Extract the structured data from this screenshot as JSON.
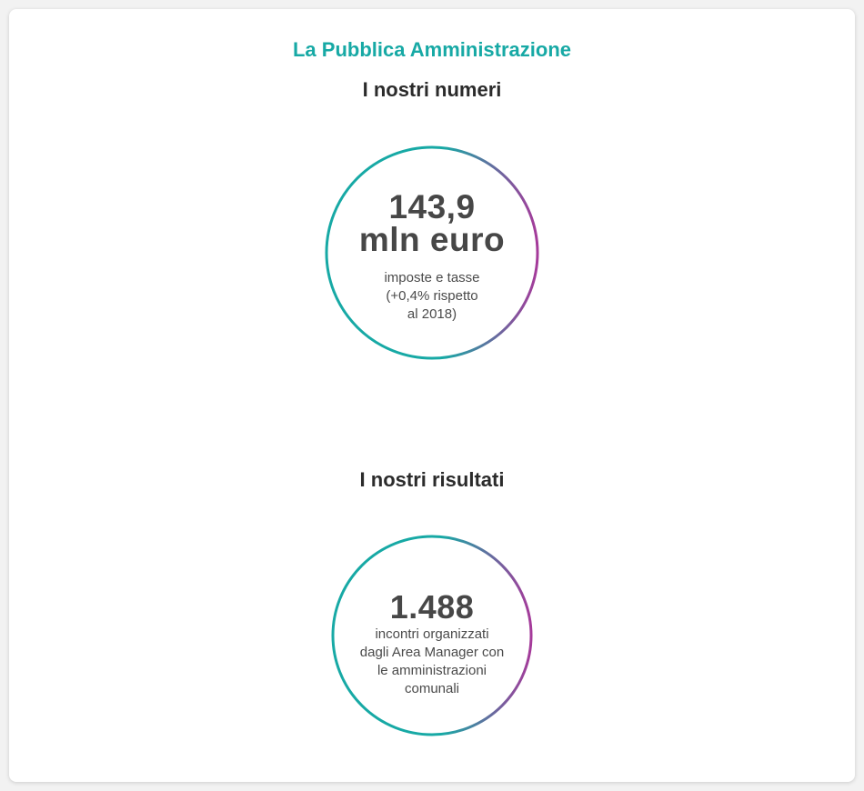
{
  "section": {
    "kicker": "La Pubblica Amministrazione",
    "numbers_title": "I nostri numeri",
    "results_title": "I nostri risultati"
  },
  "stats": {
    "taxes": {
      "value_line1": "143,9",
      "value_line2": "mln euro",
      "desc_line1": "imposte e tasse",
      "desc_line2": "(+0,4% rispetto",
      "desc_line3": "al 2018)"
    },
    "meetings": {
      "value": "1.488",
      "desc_line1": "incontri organizzati",
      "desc_line2": "dagli Area Manager con",
      "desc_line3": "le amministrazioni",
      "desc_line4": "comunali"
    }
  },
  "colors": {
    "accent_teal": "#17a9a5",
    "ring_gradient_start": "#17a9a5",
    "ring_gradient_end": "#a53a9a"
  }
}
